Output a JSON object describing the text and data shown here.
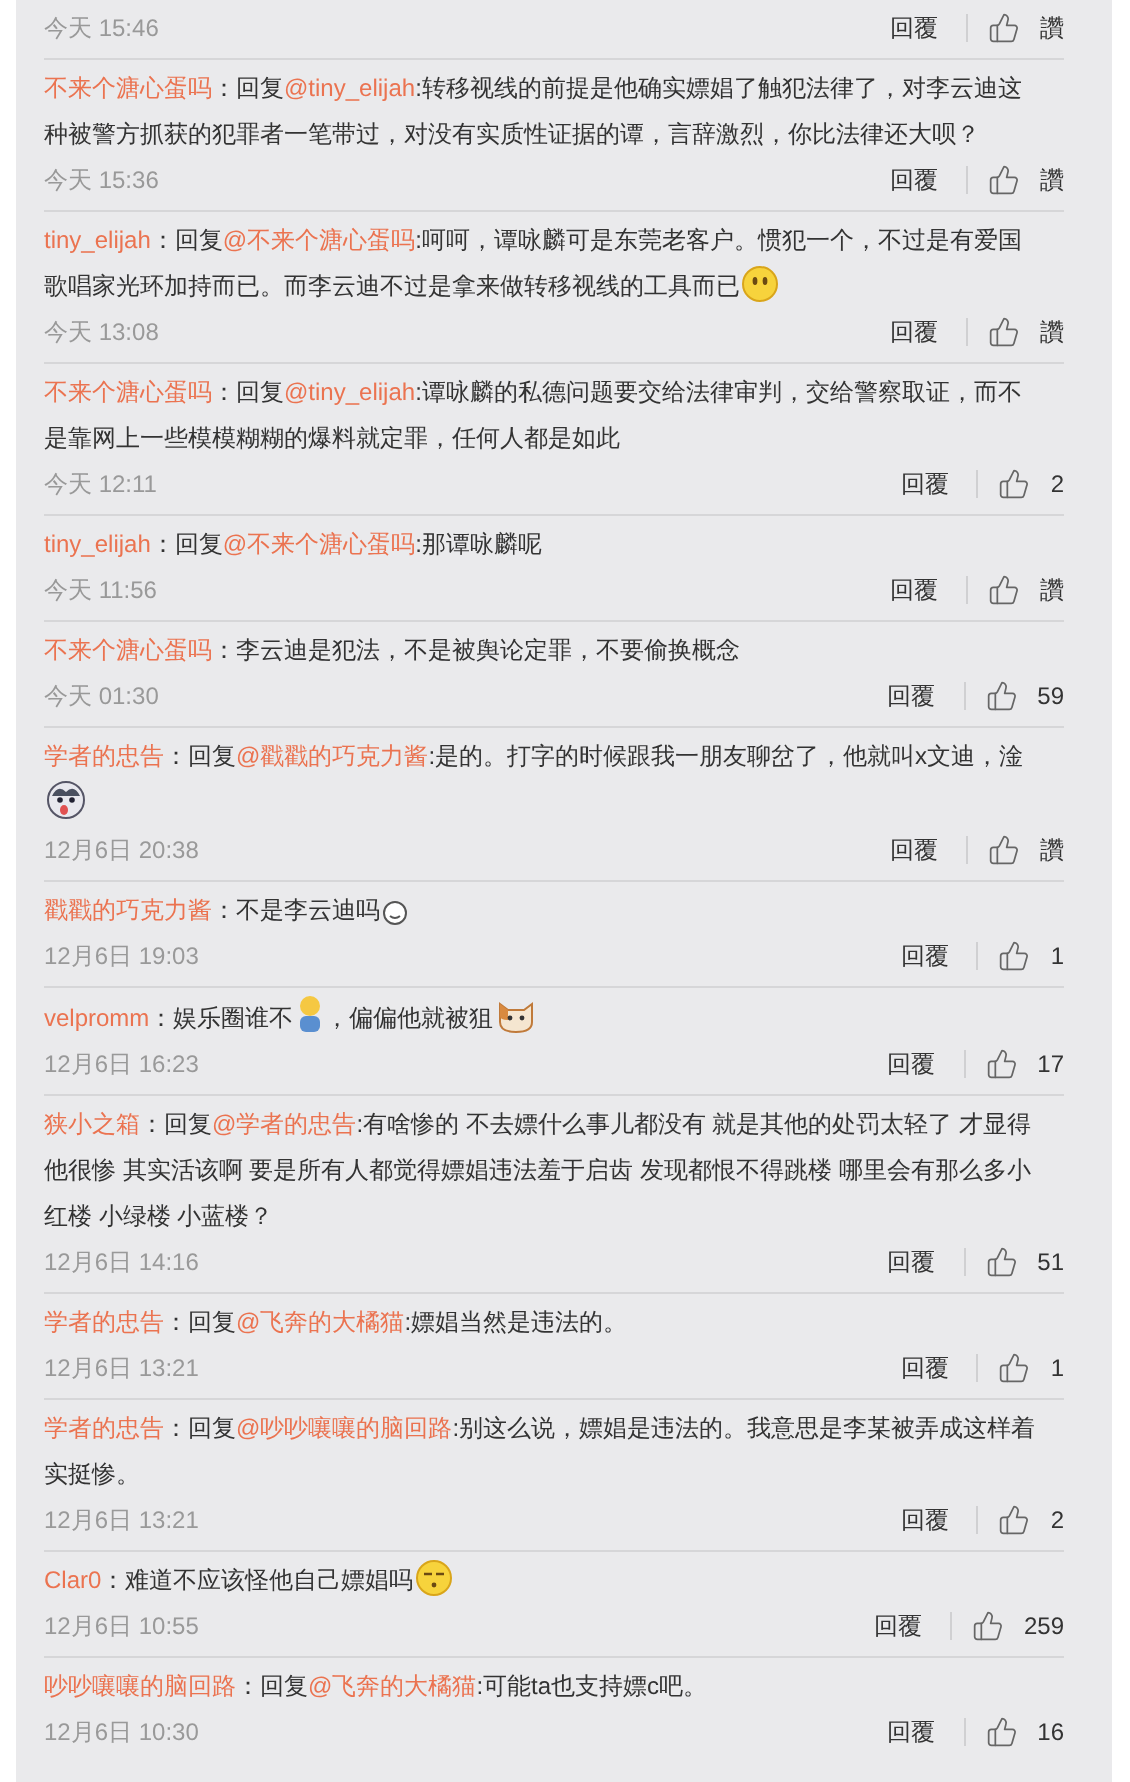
{
  "comments": [
    {
      "time": "今天 15:46",
      "reply_button": "回覆",
      "like": "讚"
    },
    {
      "user": "不来个溏心蛋吗",
      "colon": "：",
      "reply_label": "回复",
      "reply_to": "@tiny_elijah",
      "parts": [
        {
          "kind": "text",
          "text": ":转移视线的前提是他确实嫖娼了触犯法律了，对李云迪这种被警方抓获的犯罪者一笔带过，对没有实质性证据的谭，言辞激烈，你比法律还大呗？"
        }
      ],
      "time": "今天 15:36",
      "reply_button": "回覆",
      "like": "讚"
    },
    {
      "user": "tiny_elijah",
      "colon": "：",
      "reply_label": "回复",
      "reply_to": "@不来个溏心蛋吗",
      "parts": [
        {
          "kind": "text",
          "text": ":呵呵，谭咏麟可是东莞老客户。惯犯一个，不过是有爱国歌唱家光环加持而已。而李云迪不过是拿来做转移视线的工具而已"
        },
        {
          "kind": "smile"
        }
      ],
      "time": "今天 13:08",
      "reply_button": "回覆",
      "like": "讚"
    },
    {
      "user": "不来个溏心蛋吗",
      "colon": "：",
      "reply_label": "回复",
      "reply_to": "@tiny_elijah",
      "parts": [
        {
          "kind": "text",
          "text": ":谭咏麟的私德问题要交给法律审判，交给警察取证，而不是靠网上一些模模糊糊的爆料就定罪，任何人都是如此"
        }
      ],
      "time": "今天 12:11",
      "reply_button": "回覆",
      "like": "2"
    },
    {
      "user": "tiny_elijah",
      "colon": "：",
      "reply_label": "回复",
      "reply_to": "@不来个溏心蛋吗",
      "parts": [
        {
          "kind": "text",
          "text": ":那谭咏麟呢"
        }
      ],
      "time": "今天 11:56",
      "reply_button": "回覆",
      "like": "讚"
    },
    {
      "user": "不来个溏心蛋吗",
      "colon": "：",
      "parts": [
        {
          "kind": "text",
          "text": "李云迪是犯法，不是被舆论定罪，不要偷换概念"
        }
      ],
      "time": "今天 01:30",
      "reply_button": "回覆",
      "like": "59"
    },
    {
      "user": "学者的忠告",
      "colon": "：",
      "reply_label": "回复",
      "reply_to": "@戳戳的巧克力酱",
      "parts": [
        {
          "kind": "text",
          "text": ":是的。打字的时候跟我一朋友聊岔了，他就叫x文迪，淦"
        },
        {
          "kind": "dog"
        }
      ],
      "time": "12月6日 20:38",
      "reply_button": "回覆",
      "like": "讚"
    },
    {
      "user": "戳戳的巧克力酱",
      "colon": "：",
      "parts": [
        {
          "kind": "text",
          "text": "不是李云迪吗"
        },
        {
          "kind": "small"
        }
      ],
      "time": "12月6日 19:03",
      "reply_button": "回覆",
      "like": "1"
    },
    {
      "user": "velpromm",
      "colon": "：",
      "parts": [
        {
          "kind": "text",
          "text": "娱乐圈谁不"
        },
        {
          "kind": "figure"
        },
        {
          "kind": "text",
          "text": "，偏偏他就被狙"
        },
        {
          "kind": "cat"
        }
      ],
      "time": "12月6日 16:23",
      "reply_button": "回覆",
      "like": "17"
    },
    {
      "user": "狭小之箱",
      "colon": "：",
      "reply_label": "回复",
      "reply_to": "@学者的忠告",
      "parts": [
        {
          "kind": "text",
          "text": ":有啥惨的 不去嫖什么事儿都没有 就是其他的处罚太轻了 才显得他很惨 其实活该啊 要是所有人都觉得嫖娼违法羞于启齿 发现都恨不得跳楼 哪里会有那么多小红楼 小绿楼 小蓝楼？"
        }
      ],
      "time": "12月6日 14:16",
      "reply_button": "回覆",
      "like": "51"
    },
    {
      "user": "学者的忠告",
      "colon": "：",
      "reply_label": "回复",
      "reply_to": "@飞奔的大橘猫",
      "parts": [
        {
          "kind": "text",
          "text": ":嫖娼当然是违法的。"
        }
      ],
      "time": "12月6日 13:21",
      "reply_button": "回覆",
      "like": "1"
    },
    {
      "user": "学者的忠告",
      "colon": "：",
      "reply_label": "回复",
      "reply_to": "@吵吵嚷嚷的脑回路",
      "parts": [
        {
          "kind": "text",
          "text": ":别这么说，嫖娼是违法的。我意思是李某被弄成这样着实挺惨。"
        }
      ],
      "time": "12月6日 13:21",
      "reply_button": "回覆",
      "like": "2"
    },
    {
      "user": "Clar0",
      "colon": "：",
      "parts": [
        {
          "kind": "text",
          "text": "难道不应该怪他自己嫖娼吗"
        },
        {
          "kind": "sleepy"
        }
      ],
      "time": "12月6日 10:55",
      "reply_button": "回覆",
      "like": "259"
    },
    {
      "user": "吵吵嚷嚷的脑回路",
      "colon": "：",
      "reply_label": "回复",
      "reply_to": "@飞奔的大橘猫",
      "parts": [
        {
          "kind": "text",
          "text": ":可能ta也支持嫖c吧。"
        }
      ],
      "time": "12月6日 10:30",
      "reply_button": "回覆",
      "like": "16"
    }
  ]
}
